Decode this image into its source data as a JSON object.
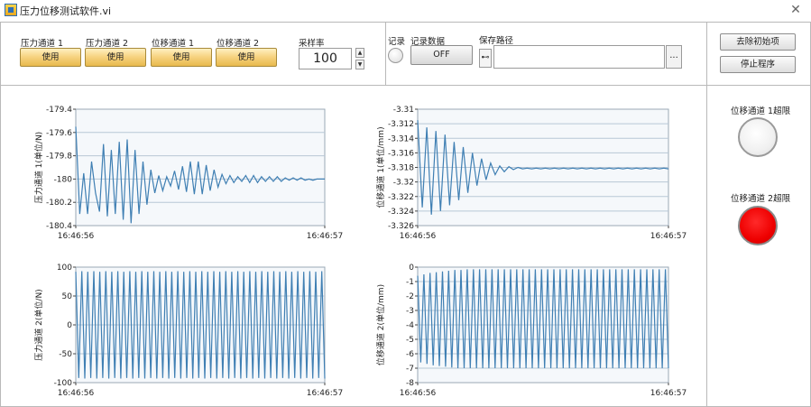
{
  "window": {
    "title": "压力位移测试软件.vi"
  },
  "controls": {
    "channels": [
      {
        "label": "压力通道 1",
        "button": "使用"
      },
      {
        "label": "压力通道 2",
        "button": "使用"
      },
      {
        "label": "位移通道 1",
        "button": "使用"
      },
      {
        "label": "位移通道 2",
        "button": "使用"
      }
    ],
    "sample_rate": {
      "label": "采样率",
      "value": "100"
    },
    "record": {
      "label": "记录",
      "data_label": "记录数据",
      "button": "OFF"
    },
    "save_path": {
      "label": "保存路径",
      "value": "",
      "browse": "..."
    },
    "buttons": {
      "clear": "去除初始项",
      "stop": "停止程序"
    },
    "leds": {
      "limit1": {
        "label": "位移通道 1超限",
        "state": "off"
      },
      "limit2": {
        "label": "位移通道 2超限",
        "state": "on",
        "color": "#ff0000"
      }
    }
  },
  "colors": {
    "series": "#3f7fb3",
    "grid": "#b8c7d6",
    "plot_bg": "#f5f8fb",
    "led_on": "#ff0000"
  },
  "chart_data": [
    {
      "type": "line",
      "ylabel": "压力通道 1(单位/N)",
      "ylim": [
        -180.4,
        -179.4
      ],
      "yticks": [
        "-179.4",
        "-179.6",
        "-179.8",
        "-180",
        "-180.2",
        "-180.4"
      ],
      "xticks": [
        "16:46:56",
        "16:46:57"
      ],
      "series": [
        {
          "values": [
            -179.55,
            -180.3,
            -179.95,
            -180.3,
            -179.85,
            -180.12,
            -180.28,
            -179.7,
            -180.32,
            -179.75,
            -180.3,
            -179.68,
            -180.35,
            -179.66,
            -180.38,
            -179.75,
            -180.3,
            -179.85,
            -180.22,
            -179.92,
            -180.12,
            -179.97,
            -180.1,
            -179.98,
            -180.06,
            -179.93,
            -180.09,
            -179.89,
            -180.11,
            -179.85,
            -180.13,
            -179.85,
            -180.13,
            -179.88,
            -180.1,
            -179.92,
            -180.07,
            -179.96,
            -180.04,
            -179.97,
            -180.03,
            -179.98,
            -180.02,
            -179.97,
            -180.03,
            -179.97,
            -180.03,
            -179.98,
            -180.02,
            -179.98,
            -180.02,
            -179.98,
            -180.02,
            -179.99,
            -180.01,
            -179.99,
            -180.01,
            -179.99,
            -180.01,
            -180.0,
            -180.01,
            -180.0,
            -180.0,
            -180.0
          ]
        }
      ]
    },
    {
      "type": "line",
      "ylabel": "位移通道 1(单位/mm)",
      "ylim": [
        -3.326,
        -3.31
      ],
      "yticks": [
        "-3.31",
        "-3.312",
        "-3.314",
        "-3.316",
        "-3.318",
        "-3.32",
        "-3.322",
        "-3.324",
        "-3.326"
      ],
      "xticks": [
        "16:46:56",
        "16:46:57"
      ],
      "series": [
        {
          "values": [
            -3.3115,
            -3.3235,
            -3.3125,
            -3.3245,
            -3.313,
            -3.324,
            -3.3135,
            -3.3232,
            -3.3145,
            -3.3225,
            -3.3152,
            -3.3215,
            -3.316,
            -3.3205,
            -3.3168,
            -3.3197,
            -3.3174,
            -3.319,
            -3.3178,
            -3.3186,
            -3.3179,
            -3.3183,
            -3.318,
            -3.3182,
            -3.3181,
            -3.3182,
            -3.3181,
            -3.3182,
            -3.3181,
            -3.3182,
            -3.3181,
            -3.3182,
            -3.3181,
            -3.3182,
            -3.3181,
            -3.3182,
            -3.3181,
            -3.3182,
            -3.3181,
            -3.3182,
            -3.3181,
            -3.3182,
            -3.3181,
            -3.3182,
            -3.3181,
            -3.3182,
            -3.3181,
            -3.3182,
            -3.3181,
            -3.3182,
            -3.3181,
            -3.3182,
            -3.3181,
            -3.3182,
            -3.3181,
            -3.3182
          ]
        }
      ]
    },
    {
      "type": "line",
      "ylabel": "压力通道 2(单位/N)",
      "ylim": [
        -100,
        100
      ],
      "yticks": [
        "100",
        "50",
        "0",
        "-50",
        "-100"
      ],
      "xticks": [
        "16:46:56",
        "16:46:57"
      ],
      "series": [
        {
          "values": [
            92,
            -92,
            93,
            -93,
            92,
            -92,
            93,
            -93,
            92,
            -92,
            93,
            -93,
            92,
            -92,
            93,
            -93,
            92,
            -92,
            93,
            -93,
            92,
            -92,
            93,
            -93,
            92,
            -92,
            93,
            -93,
            92,
            -92,
            93,
            -93,
            92,
            -92,
            93,
            -93,
            92,
            -92,
            93,
            -93,
            92,
            -92,
            93,
            -93,
            92,
            -92,
            93,
            -93,
            92,
            -92,
            93,
            -93,
            92,
            -92,
            93,
            -93,
            92,
            -92,
            93,
            -93,
            92,
            -92,
            93,
            -93,
            92,
            -92,
            93,
            -93,
            92,
            -92,
            93,
            -93,
            92,
            -92,
            93,
            -93,
            92,
            -92,
            93,
            -93,
            92,
            -92,
            93,
            -93
          ]
        }
      ]
    },
    {
      "type": "line",
      "ylabel": "位移通道 2(单位/mm)",
      "ylim": [
        -8,
        0
      ],
      "yticks": [
        "0",
        "-1",
        "-2",
        "-3",
        "-4",
        "-5",
        "-6",
        "-7",
        "-8"
      ],
      "xticks": [
        "16:46:56",
        "16:46:57"
      ],
      "series": [
        {
          "values": [
            -0.6,
            -6.6,
            -0.5,
            -6.7,
            -0.4,
            -6.8,
            -0.35,
            -6.85,
            -0.3,
            -6.9,
            -0.25,
            -6.95,
            -0.2,
            -7.0,
            -0.2,
            -7.0,
            -0.15,
            -7.0,
            -0.15,
            -7.0,
            -0.15,
            -7.0,
            -0.15,
            -7.0,
            -0.15,
            -7.0,
            -0.15,
            -7.0,
            -0.15,
            -7.0,
            -0.15,
            -7.0,
            -0.15,
            -7.0,
            -0.15,
            -7.0,
            -0.15,
            -7.0,
            -0.15,
            -7.0,
            -0.15,
            -7.0,
            -0.15,
            -7.0,
            -0.15,
            -7.0,
            -0.15,
            -7.0,
            -0.15,
            -7.0,
            -0.15,
            -7.0,
            -0.15,
            -7.0,
            -0.15,
            -7.0,
            -0.15,
            -7.0,
            -0.15,
            -7.0,
            -0.15,
            -7.0,
            -0.15,
            -7.0,
            -0.15,
            -7.0,
            -0.15,
            -7.0,
            -0.15,
            -7.0,
            -0.15,
            -7.0,
            -0.15,
            -7.0,
            -0.15,
            -7.0,
            -0.15,
            -7.0,
            -0.15,
            -7.0,
            -0.15,
            -7.0
          ]
        }
      ]
    }
  ]
}
